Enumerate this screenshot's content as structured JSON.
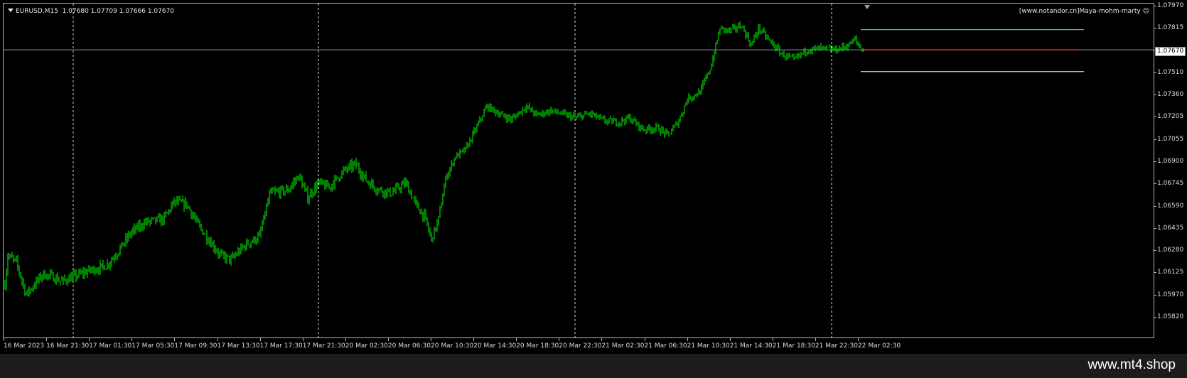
{
  "header": {
    "symbol": "EURUSD,M15",
    "ohlc": "1.07680 1.07709 1.07666 1.07670"
  },
  "watermark": "[www.notandor.cn]Maya-mohm-marty",
  "watermark_icon": "smiley-icon",
  "price_axis": {
    "labels": [
      "1.07970",
      "1.07815",
      "1.07670",
      "1.07510",
      "1.07360",
      "1.07205",
      "1.07055",
      "1.06900",
      "1.06745",
      "1.06590",
      "1.06435",
      "1.06280",
      "1.06125",
      "1.05970",
      "1.05820"
    ],
    "max": 1.0797,
    "min": 1.0582,
    "current": "1.07670"
  },
  "time_axis": {
    "labels": [
      "16 Mar 2023",
      "16 Mar 21:30",
      "17 Mar 01:30",
      "17 Mar 05:30",
      "17 Mar 09:30",
      "17 Mar 13:30",
      "17 Mar 17:30",
      "17 Mar 21:30",
      "20 Mar 02:30",
      "20 Mar 06:30",
      "20 Mar 10:30",
      "20 Mar 14:30",
      "20 Mar 18:30",
      "20 Mar 22:30",
      "21 Mar 02:30",
      "21 Mar 06:30",
      "21 Mar 10:30",
      "21 Mar 14:30",
      "21 Mar 18:30",
      "21 Mar 22:30",
      "22 Mar 02:30"
    ]
  },
  "levels": {
    "upper": 1.0781,
    "current": 1.0767,
    "lower": 1.0752
  },
  "colors": {
    "candle": "#00ff00",
    "bid_line": "#7f9aa8",
    "upper_level": "#3fb6c8",
    "current_level": "#ff3b3b",
    "lower_level": "#ff9aa8",
    "separator": "#ffffff"
  },
  "site": "www.mt4.shop"
}
